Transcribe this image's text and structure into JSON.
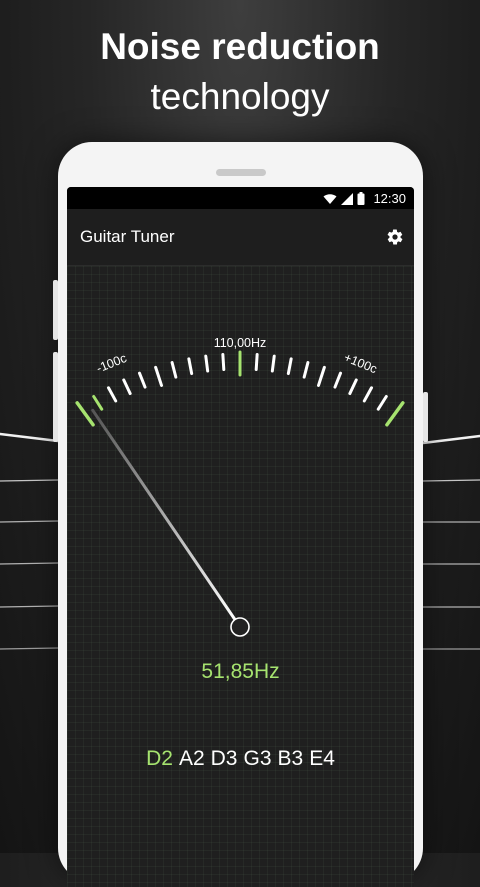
{
  "promo": {
    "title": "Noise reduction",
    "subtitle": "technology"
  },
  "status_bar": {
    "time": "12:30",
    "icons": [
      "wifi-icon",
      "cell-signal-icon",
      "battery-icon"
    ]
  },
  "app_bar": {
    "title": "Guitar Tuner",
    "settings_icon": "gear-icon"
  },
  "tuner": {
    "target_frequency": "110,00Hz",
    "min_label": "-100c",
    "max_label": "+100c",
    "needle_cents": -95,
    "detected_frequency": "51,85Hz",
    "accent_color": "#a6e36f"
  },
  "strings": {
    "notes": [
      "D2",
      "A2",
      "D3",
      "G3",
      "B3",
      "E4"
    ],
    "active_index": 0
  }
}
